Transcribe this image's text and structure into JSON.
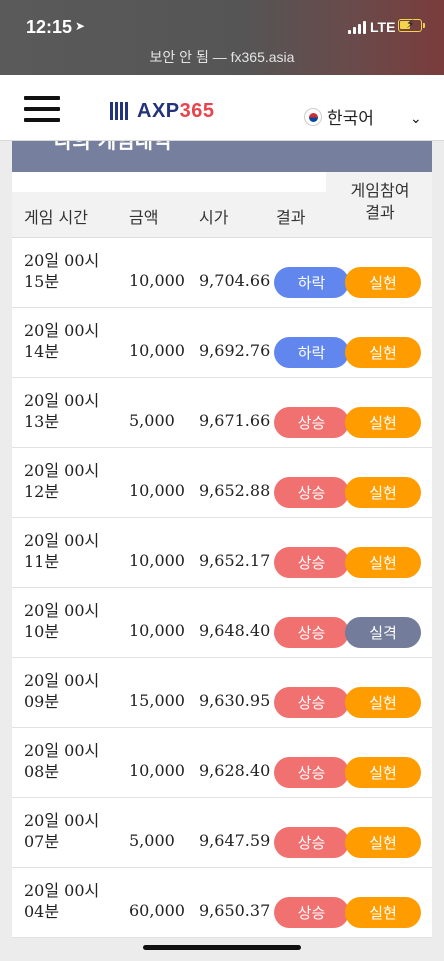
{
  "status_bar": {
    "time": "12:15",
    "network": "LTE",
    "url_prefix": "보안 안 됨 — ",
    "url_host": "fx365.asia"
  },
  "header": {
    "logo_a": "AXP",
    "logo_b": "365",
    "language": "한국어"
  },
  "page": {
    "title_partial": "나의 게임내역"
  },
  "table": {
    "columns": {
      "time": "게임 시간",
      "amount": "금액",
      "price": "시가",
      "result": "결과",
      "participation": "게임참여\n결과"
    },
    "rows": [
      {
        "time": "20일 00시\n15분",
        "amount": "10,000",
        "price": "9,704.66",
        "result": "하락",
        "participation": "실현",
        "result_color": "#6187ee",
        "part_color": "#ff9d00"
      },
      {
        "time": "20일 00시\n14분",
        "amount": "10,000",
        "price": "9,692.76",
        "result": "하락",
        "participation": "실현",
        "result_color": "#6187ee",
        "part_color": "#ff9d00"
      },
      {
        "time": "20일 00시\n13분",
        "amount": "5,000",
        "price": "9,671.66",
        "result": "상승",
        "participation": "실현",
        "result_color": "#f17171",
        "part_color": "#ff9d00"
      },
      {
        "time": "20일 00시\n12분",
        "amount": "10,000",
        "price": "9,652.88",
        "result": "상승",
        "participation": "실현",
        "result_color": "#f17171",
        "part_color": "#ff9d00"
      },
      {
        "time": "20일 00시\n11분",
        "amount": "10,000",
        "price": "9,652.17",
        "result": "상승",
        "participation": "실현",
        "result_color": "#f17171",
        "part_color": "#ff9d00"
      },
      {
        "time": "20일 00시\n10분",
        "amount": "10,000",
        "price": "9,648.40",
        "result": "상승",
        "participation": "실격",
        "result_color": "#f17171",
        "part_color": "#737c9b"
      },
      {
        "time": "20일 00시\n09분",
        "amount": "15,000",
        "price": "9,630.95",
        "result": "상승",
        "participation": "실현",
        "result_color": "#f17171",
        "part_color": "#ff9d00"
      },
      {
        "time": "20일 00시\n08분",
        "amount": "10,000",
        "price": "9,628.40",
        "result": "상승",
        "participation": "실현",
        "result_color": "#f17171",
        "part_color": "#ff9d00"
      },
      {
        "time": "20일 00시\n07분",
        "amount": "5,000",
        "price": "9,647.59",
        "result": "상승",
        "participation": "실현",
        "result_color": "#f17171",
        "part_color": "#ff9d00"
      },
      {
        "time": "20일 00시\n04분",
        "amount": "60,000",
        "price": "9,650.37",
        "result": "상승",
        "participation": "실현",
        "result_color": "#f17171",
        "part_color": "#ff9d00"
      }
    ]
  }
}
